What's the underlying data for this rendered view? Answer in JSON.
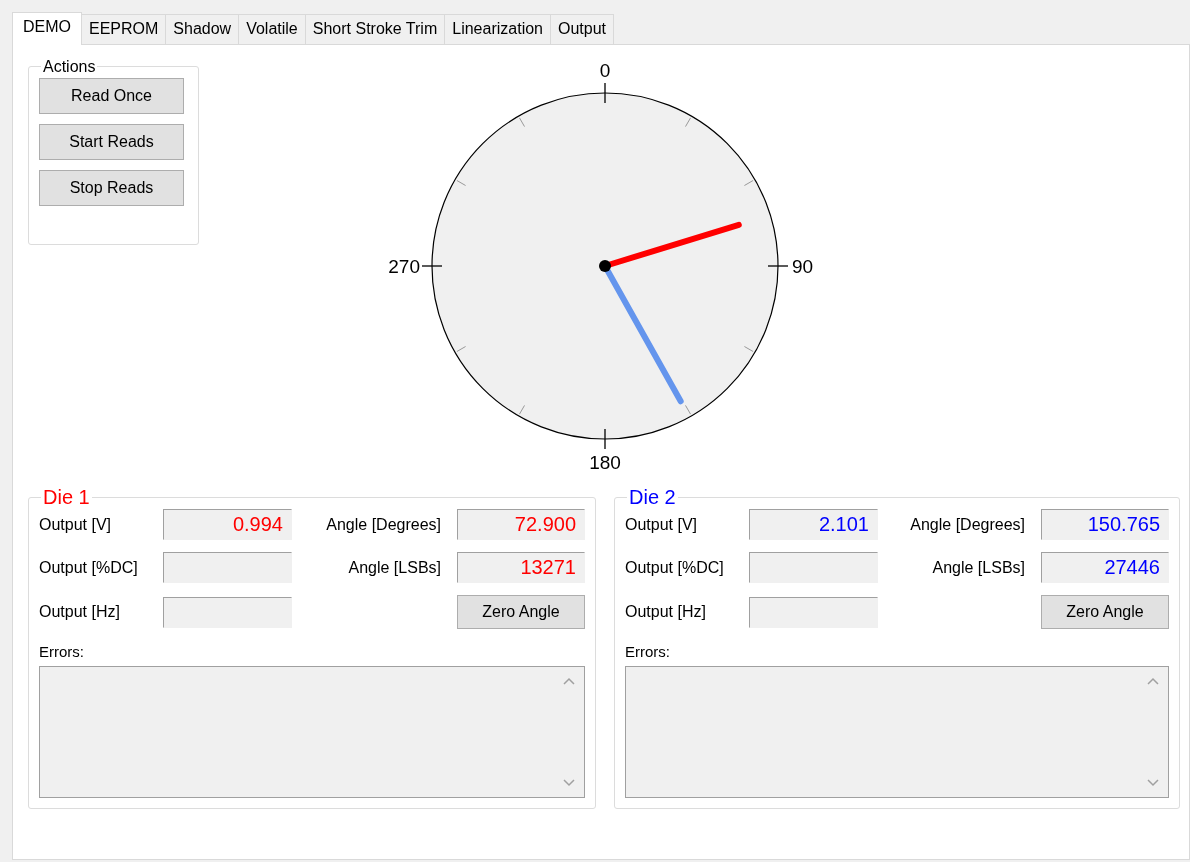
{
  "tabs": [
    {
      "label": "DEMO",
      "selected": true
    },
    {
      "label": "EEPROM",
      "selected": false
    },
    {
      "label": "Shadow",
      "selected": false
    },
    {
      "label": "Volatile",
      "selected": false
    },
    {
      "label": "Short Stroke Trim",
      "selected": false
    },
    {
      "label": "Linearization",
      "selected": false
    },
    {
      "label": "Output",
      "selected": false
    }
  ],
  "actions": {
    "title": "Actions",
    "buttons": [
      "Read Once",
      "Start Reads",
      "Stop Reads"
    ]
  },
  "dial": {
    "labels": [
      "0",
      "90",
      "180",
      "270"
    ],
    "needles": [
      {
        "color": "#ff0000"
      },
      {
        "color": "#6495ed"
      }
    ]
  },
  "dies": [
    {
      "title": "Die 1",
      "color": "#ff0000",
      "fields": [
        {
          "label": "Output [V]",
          "value": "0.994"
        },
        {
          "label": "Output [%DC]"
        },
        {
          "label": "Output [Hz]"
        }
      ],
      "angles": [
        {
          "label": "Angle [Degrees]",
          "value": "72.900"
        },
        {
          "label": "Angle [LSBs]",
          "value": "13271"
        }
      ],
      "button": "Zero Angle",
      "errors_label": "Errors:"
    },
    {
      "title": "Die 2",
      "color": "#0000ff",
      "fields": [
        {
          "label": "Output [V]",
          "value": "2.101"
        },
        {
          "label": "Output [%DC]"
        },
        {
          "label": "Output [Hz]"
        }
      ],
      "angles": [
        {
          "label": "Angle [Degrees]",
          "value": "150.765"
        },
        {
          "label": "Angle [LSBs]",
          "value": "27446"
        }
      ],
      "button": "Zero Angle",
      "errors_label": "Errors:"
    }
  ]
}
